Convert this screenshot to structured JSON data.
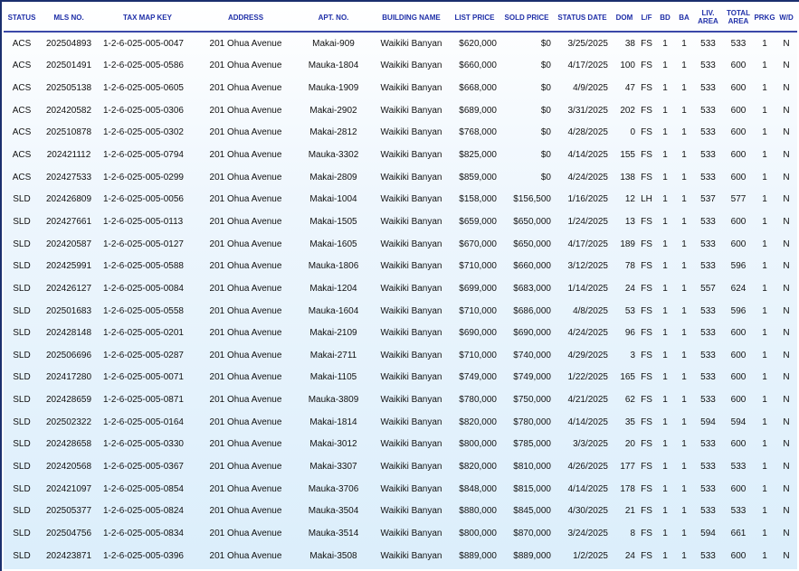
{
  "columns": [
    "STATUS",
    "MLS NO.",
    "TAX MAP KEY",
    "ADDRESS",
    "APT. NO.",
    "BUILDING NAME",
    "LIST PRICE",
    "SOLD PRICE",
    "STATUS DATE",
    "DOM",
    "L/F",
    "BD",
    "BA",
    "LIV. AREA",
    "TOTAL AREA",
    "PRKG",
    "W/D"
  ],
  "rows": [
    [
      "ACS",
      "202504893",
      "1-2-6-025-005-0047",
      "201 Ohua Avenue",
      "Makai-909",
      "Waikiki Banyan",
      "$620,000",
      "$0",
      "3/25/2025",
      "38",
      "FS",
      "1",
      "1",
      "533",
      "533",
      "1",
      "N"
    ],
    [
      "ACS",
      "202501491",
      "1-2-6-025-005-0586",
      "201 Ohua Avenue",
      "Mauka-1804",
      "Waikiki Banyan",
      "$660,000",
      "$0",
      "4/17/2025",
      "100",
      "FS",
      "1",
      "1",
      "533",
      "600",
      "1",
      "N"
    ],
    [
      "ACS",
      "202505138",
      "1-2-6-025-005-0605",
      "201 Ohua Avenue",
      "Mauka-1909",
      "Waikiki Banyan",
      "$668,000",
      "$0",
      "4/9/2025",
      "47",
      "FS",
      "1",
      "1",
      "533",
      "600",
      "1",
      "N"
    ],
    [
      "ACS",
      "202420582",
      "1-2-6-025-005-0306",
      "201 Ohua Avenue",
      "Makai-2902",
      "Waikiki Banyan",
      "$689,000",
      "$0",
      "3/31/2025",
      "202",
      "FS",
      "1",
      "1",
      "533",
      "600",
      "1",
      "N"
    ],
    [
      "ACS",
      "202510878",
      "1-2-6-025-005-0302",
      "201 Ohua Avenue",
      "Makai-2812",
      "Waikiki Banyan",
      "$768,000",
      "$0",
      "4/28/2025",
      "0",
      "FS",
      "1",
      "1",
      "533",
      "600",
      "1",
      "N"
    ],
    [
      "ACS",
      "202421112",
      "1-2-6-025-005-0794",
      "201 Ohua Avenue",
      "Mauka-3302",
      "Waikiki Banyan",
      "$825,000",
      "$0",
      "4/14/2025",
      "155",
      "FS",
      "1",
      "1",
      "533",
      "600",
      "1",
      "N"
    ],
    [
      "ACS",
      "202427533",
      "1-2-6-025-005-0299",
      "201 Ohua Avenue",
      "Makai-2809",
      "Waikiki Banyan",
      "$859,000",
      "$0",
      "4/24/2025",
      "138",
      "FS",
      "1",
      "1",
      "533",
      "600",
      "1",
      "N"
    ],
    [
      "SLD",
      "202426809",
      "1-2-6-025-005-0056",
      "201 Ohua Avenue",
      "Makai-1004",
      "Waikiki Banyan",
      "$158,000",
      "$156,500",
      "1/16/2025",
      "12",
      "LH",
      "1",
      "1",
      "537",
      "577",
      "1",
      "N"
    ],
    [
      "SLD",
      "202427661",
      "1-2-6-025-005-0113",
      "201 Ohua Avenue",
      "Makai-1505",
      "Waikiki Banyan",
      "$659,000",
      "$650,000",
      "1/24/2025",
      "13",
      "FS",
      "1",
      "1",
      "533",
      "600",
      "1",
      "N"
    ],
    [
      "SLD",
      "202420587",
      "1-2-6-025-005-0127",
      "201 Ohua Avenue",
      "Makai-1605",
      "Waikiki Banyan",
      "$670,000",
      "$650,000",
      "4/17/2025",
      "189",
      "FS",
      "1",
      "1",
      "533",
      "600",
      "1",
      "N"
    ],
    [
      "SLD",
      "202425991",
      "1-2-6-025-005-0588",
      "201 Ohua Avenue",
      "Mauka-1806",
      "Waikiki Banyan",
      "$710,000",
      "$660,000",
      "3/12/2025",
      "78",
      "FS",
      "1",
      "1",
      "533",
      "596",
      "1",
      "N"
    ],
    [
      "SLD",
      "202426127",
      "1-2-6-025-005-0084",
      "201 Ohua Avenue",
      "Makai-1204",
      "Waikiki Banyan",
      "$699,000",
      "$683,000",
      "1/14/2025",
      "24",
      "FS",
      "1",
      "1",
      "557",
      "624",
      "1",
      "N"
    ],
    [
      "SLD",
      "202501683",
      "1-2-6-025-005-0558",
      "201 Ohua Avenue",
      "Mauka-1604",
      "Waikiki Banyan",
      "$710,000",
      "$686,000",
      "4/8/2025",
      "53",
      "FS",
      "1",
      "1",
      "533",
      "596",
      "1",
      "N"
    ],
    [
      "SLD",
      "202428148",
      "1-2-6-025-005-0201",
      "201 Ohua Avenue",
      "Makai-2109",
      "Waikiki Banyan",
      "$690,000",
      "$690,000",
      "4/24/2025",
      "96",
      "FS",
      "1",
      "1",
      "533",
      "600",
      "1",
      "N"
    ],
    [
      "SLD",
      "202506696",
      "1-2-6-025-005-0287",
      "201 Ohua Avenue",
      "Makai-2711",
      "Waikiki Banyan",
      "$710,000",
      "$740,000",
      "4/29/2025",
      "3",
      "FS",
      "1",
      "1",
      "533",
      "600",
      "1",
      "N"
    ],
    [
      "SLD",
      "202417280",
      "1-2-6-025-005-0071",
      "201 Ohua Avenue",
      "Makai-1105",
      "Waikiki Banyan",
      "$749,000",
      "$749,000",
      "1/22/2025",
      "165",
      "FS",
      "1",
      "1",
      "533",
      "600",
      "1",
      "N"
    ],
    [
      "SLD",
      "202428659",
      "1-2-6-025-005-0871",
      "201 Ohua Avenue",
      "Mauka-3809",
      "Waikiki Banyan",
      "$780,000",
      "$750,000",
      "4/21/2025",
      "62",
      "FS",
      "1",
      "1",
      "533",
      "600",
      "1",
      "N"
    ],
    [
      "SLD",
      "202502322",
      "1-2-6-025-005-0164",
      "201 Ohua Avenue",
      "Makai-1814",
      "Waikiki Banyan",
      "$820,000",
      "$780,000",
      "4/14/2025",
      "35",
      "FS",
      "1",
      "1",
      "594",
      "594",
      "1",
      "N"
    ],
    [
      "SLD",
      "202428658",
      "1-2-6-025-005-0330",
      "201 Ohua Avenue",
      "Makai-3012",
      "Waikiki Banyan",
      "$800,000",
      "$785,000",
      "3/3/2025",
      "20",
      "FS",
      "1",
      "1",
      "533",
      "600",
      "1",
      "N"
    ],
    [
      "SLD",
      "202420568",
      "1-2-6-025-005-0367",
      "201 Ohua Avenue",
      "Makai-3307",
      "Waikiki Banyan",
      "$820,000",
      "$810,000",
      "4/26/2025",
      "177",
      "FS",
      "1",
      "1",
      "533",
      "533",
      "1",
      "N"
    ],
    [
      "SLD",
      "202421097",
      "1-2-6-025-005-0854",
      "201 Ohua Avenue",
      "Mauka-3706",
      "Waikiki Banyan",
      "$848,000",
      "$815,000",
      "4/14/2025",
      "178",
      "FS",
      "1",
      "1",
      "533",
      "600",
      "1",
      "N"
    ],
    [
      "SLD",
      "202505377",
      "1-2-6-025-005-0824",
      "201 Ohua Avenue",
      "Mauka-3504",
      "Waikiki Banyan",
      "$880,000",
      "$845,000",
      "4/30/2025",
      "21",
      "FS",
      "1",
      "1",
      "533",
      "533",
      "1",
      "N"
    ],
    [
      "SLD",
      "202504756",
      "1-2-6-025-005-0834",
      "201 Ohua Avenue",
      "Mauka-3514",
      "Waikiki Banyan",
      "$800,000",
      "$870,000",
      "3/24/2025",
      "8",
      "FS",
      "1",
      "1",
      "594",
      "661",
      "1",
      "N"
    ],
    [
      "SLD",
      "202423871",
      "1-2-6-025-005-0396",
      "201 Ohua Avenue",
      "Makai-3508",
      "Waikiki Banyan",
      "$889,000",
      "$889,000",
      "1/2/2025",
      "24",
      "FS",
      "1",
      "1",
      "533",
      "600",
      "1",
      "N"
    ]
  ]
}
